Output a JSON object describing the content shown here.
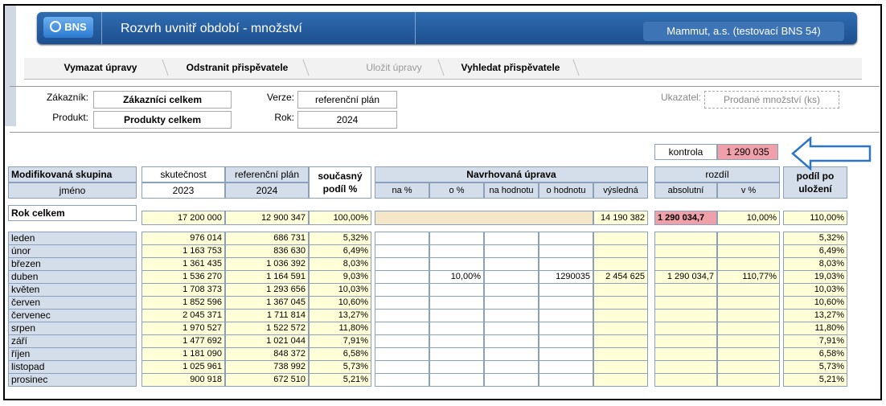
{
  "titlebar": {
    "logo": "BNS",
    "title": "Rozvrh uvnitř období - množství",
    "company": "Mammut, a.s. (testovací BNS 54)"
  },
  "toolbar": {
    "clear": "Vymazat úpravy",
    "remove": "Odstranit přispěvatele",
    "save": "Uložit úpravy",
    "find": "Vyhledat přispěvatele"
  },
  "filters": {
    "zakaznik_label": "Zákazník:",
    "zakaznik_value": "Zákazníci celkem",
    "produkt_label": "Produkt:",
    "produkt_value": "Produkty celkem",
    "verze_label": "Verze:",
    "verze_value": "referenční plán",
    "rok_label": "Rok:",
    "rok_value": "2024",
    "ukazatel_label": "Ukazatel:",
    "ukazatel_value": "Prodané množství (ks)"
  },
  "kontrola": {
    "label": "kontrola",
    "value": "1 290 035"
  },
  "headers": {
    "group": "Modifikovaná skupina",
    "name": "jméno",
    "actual": "skutečnost",
    "actual_year": "2023",
    "plan": "referenční plán",
    "plan_year": "2024",
    "share": "současný podíl %",
    "proposed": "Navrhovaná úprava",
    "na_pct": "na %",
    "o_pct": "o %",
    "na_val": "na hodnotu",
    "o_val": "o hodnotu",
    "result": "výsledná",
    "diff": "rozdíl",
    "abs": "absolutní",
    "v_pct": "v %",
    "after": "podíl po uložení"
  },
  "total": {
    "label": "Rok celkem",
    "actual": "17 200 000",
    "plan": "12 900 347",
    "share": "100,00%",
    "result": "14 190 382",
    "abs": "1 290 034,7",
    "v_pct": "10,00%",
    "after": "110,00%"
  },
  "rows": [
    {
      "name": "leden",
      "actual": "976 014",
      "plan": "686 731",
      "share": "5,32%",
      "o_pct": "",
      "o_val": "",
      "result": "",
      "abs": "",
      "v_pct": "",
      "after": "5,32%"
    },
    {
      "name": "únor",
      "actual": "1 163 753",
      "plan": "836 630",
      "share": "6,49%",
      "o_pct": "",
      "o_val": "",
      "result": "",
      "abs": "",
      "v_pct": "",
      "after": "6,49%"
    },
    {
      "name": "březen",
      "actual": "1 361 435",
      "plan": "1 036 392",
      "share": "8,03%",
      "o_pct": "",
      "o_val": "",
      "result": "",
      "abs": "",
      "v_pct": "",
      "after": "8,03%"
    },
    {
      "name": "duben",
      "actual": "1 536 270",
      "plan": "1 164 591",
      "share": "9,03%",
      "o_pct": "10,00%",
      "o_val": "1290035",
      "result": "2 454 625",
      "abs": "1 290 034,7",
      "v_pct": "110,77%",
      "after": "19,03%"
    },
    {
      "name": "květen",
      "actual": "1 708 373",
      "plan": "1 293 656",
      "share": "10,03%",
      "o_pct": "",
      "o_val": "",
      "result": "",
      "abs": "",
      "v_pct": "",
      "after": "10,03%"
    },
    {
      "name": "červen",
      "actual": "1 852 596",
      "plan": "1 367 045",
      "share": "10,60%",
      "o_pct": "",
      "o_val": "",
      "result": "",
      "abs": "",
      "v_pct": "",
      "after": "10,60%"
    },
    {
      "name": "červenec",
      "actual": "2 045 371",
      "plan": "1 711 814",
      "share": "13,27%",
      "o_pct": "",
      "o_val": "",
      "result": "",
      "abs": "",
      "v_pct": "",
      "after": "13,27%"
    },
    {
      "name": "srpen",
      "actual": "1 970 527",
      "plan": "1 522 572",
      "share": "11,80%",
      "o_pct": "",
      "o_val": "",
      "result": "",
      "abs": "",
      "v_pct": "",
      "after": "11,80%"
    },
    {
      "name": "září",
      "actual": "1 477 692",
      "plan": "1 021 044",
      "share": "7,91%",
      "o_pct": "",
      "o_val": "",
      "result": "",
      "abs": "",
      "v_pct": "",
      "after": "7,91%"
    },
    {
      "name": "říjen",
      "actual": "1 181 090",
      "plan": "848 372",
      "share": "6,58%",
      "o_pct": "",
      "o_val": "",
      "result": "",
      "abs": "",
      "v_pct": "",
      "after": "6,58%"
    },
    {
      "name": "listopad",
      "actual": "1 025 961",
      "plan": "738 992",
      "share": "5,73%",
      "o_pct": "",
      "o_val": "",
      "result": "",
      "abs": "",
      "v_pct": "",
      "after": "5,73%"
    },
    {
      "name": "prosinec",
      "actual": "900 918",
      "plan": "672 510",
      "share": "5,21%",
      "o_pct": "",
      "o_val": "",
      "result": "",
      "abs": "",
      "v_pct": "",
      "after": "5,21%"
    }
  ]
}
